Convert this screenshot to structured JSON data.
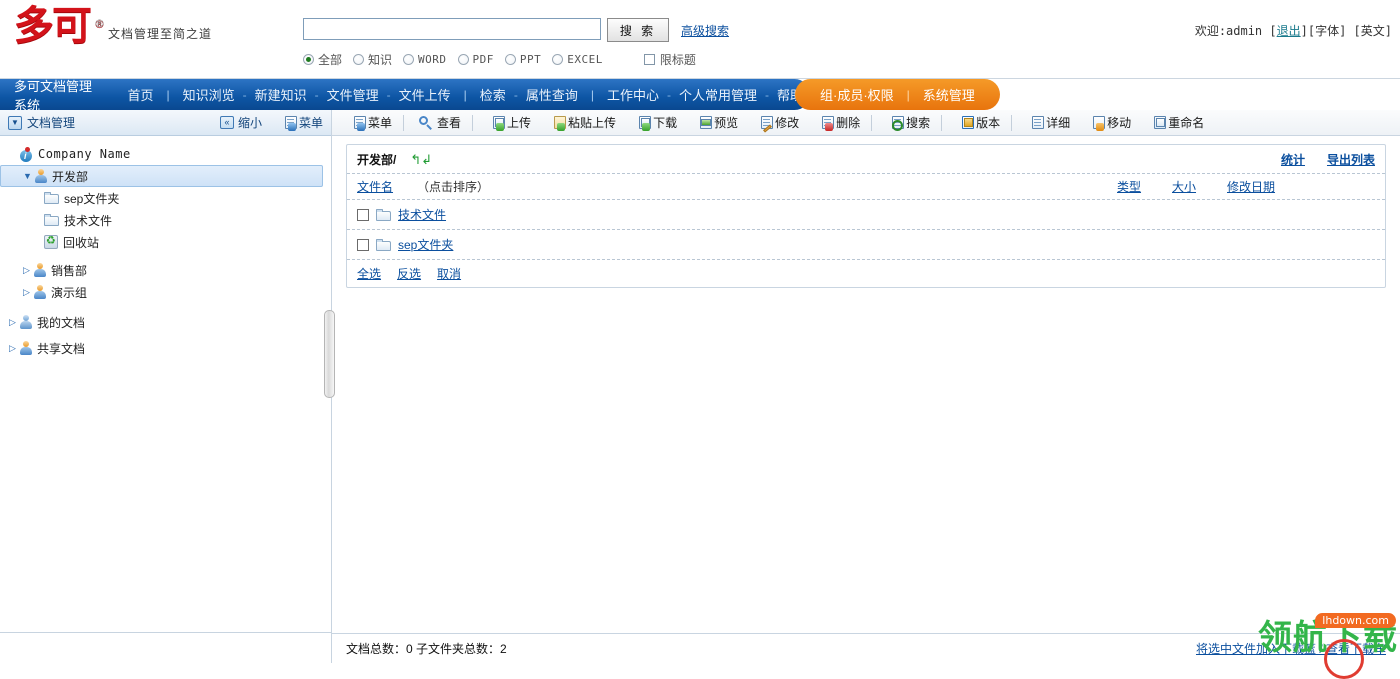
{
  "header": {
    "logo_text": "多可",
    "logo_reg": "®",
    "tagline": "文档管理至简之道",
    "search": {
      "value": "",
      "placeholder": "",
      "button_label": "搜 索",
      "advanced_label": "高级搜索",
      "filters": [
        {
          "label": "全部",
          "selected": true,
          "mono": false
        },
        {
          "label": "知识",
          "selected": false,
          "mono": false
        },
        {
          "label": "WORD",
          "selected": false,
          "mono": true
        },
        {
          "label": "PDF",
          "selected": false,
          "mono": true
        },
        {
          "label": "PPT",
          "selected": false,
          "mono": true
        },
        {
          "label": "EXCEL",
          "selected": false,
          "mono": true
        }
      ],
      "title_only_label": "限标题",
      "title_only_checked": false
    },
    "welcome_prefix": "欢迎:admin [",
    "logout_label": "退出",
    "welcome_suffix": "][字体] [英文]"
  },
  "nav": {
    "brand": "多可文档管理系统",
    "primary": [
      {
        "label": "首页",
        "sep_after": "bar"
      },
      {
        "label": "知识浏览",
        "sep_after": "dash"
      },
      {
        "label": "新建知识",
        "sep_after": "dash"
      },
      {
        "label": "文件管理",
        "sep_after": "dash"
      },
      {
        "label": "文件上传",
        "sep_after": "bar"
      },
      {
        "label": "检索",
        "sep_after": "dash"
      },
      {
        "label": "属性查询",
        "sep_after": "bar"
      },
      {
        "label": "工作中心",
        "sep_after": "dash"
      },
      {
        "label": "个人常用管理",
        "sep_after": "dash"
      },
      {
        "label": "帮助",
        "sep_after": "none"
      }
    ],
    "admin": [
      {
        "label": "组·成员·权限",
        "sep_after": "bar"
      },
      {
        "label": "系统管理",
        "sep_after": "none"
      }
    ],
    "accent_blue": "#0d55a4",
    "accent_orange": "#ee860f"
  },
  "sidebar": {
    "panel_title": "文档管理",
    "minimize_label": "缩小",
    "menu_label": "菜单",
    "tree": [
      {
        "label": "Company Name",
        "icon": "info-icon",
        "level": 0,
        "twist": "",
        "selected": false,
        "mono": true
      },
      {
        "label": "开发部",
        "icon": "group-icon",
        "level": 1,
        "twist": "▼",
        "selected": true,
        "mono": false
      },
      {
        "label": "sep文件夹",
        "icon": "folder-icon",
        "level": 2,
        "twist": "",
        "selected": false,
        "mono": false
      },
      {
        "label": "技术文件",
        "icon": "folder-icon",
        "level": 2,
        "twist": "",
        "selected": false,
        "mono": false
      },
      {
        "label": "回收站",
        "icon": "recycle-icon",
        "level": 2,
        "twist": "",
        "selected": false,
        "mono": false
      },
      {
        "label": "销售部",
        "icon": "group-icon",
        "level": 1,
        "twist": "▷",
        "selected": false,
        "mono": false
      },
      {
        "label": "演示组",
        "icon": "group-icon",
        "level": 1,
        "twist": "▷",
        "selected": false,
        "mono": false
      },
      {
        "label": "我的文档",
        "icon": "user-icon",
        "level": 0,
        "twist": "▷",
        "selected": false,
        "mono": false
      },
      {
        "label": "共享文档",
        "icon": "shared-icon",
        "level": 0,
        "twist": "▷",
        "selected": false,
        "mono": false
      }
    ]
  },
  "toolbar": [
    {
      "label": "菜单",
      "icon": "menu-icon",
      "sep_before": false
    },
    {
      "label": "查看",
      "icon": "view-icon",
      "sep_before": true
    },
    {
      "label": "上传",
      "icon": "upload-icon",
      "sep_before": true
    },
    {
      "label": "粘贴上传",
      "icon": "paste-upload-icon",
      "sep_before": false
    },
    {
      "label": "下载",
      "icon": "download-icon",
      "sep_before": false
    },
    {
      "label": "预览",
      "icon": "preview-icon",
      "sep_before": false
    },
    {
      "label": "修改",
      "icon": "edit-icon",
      "sep_before": false
    },
    {
      "label": "删除",
      "icon": "delete-icon",
      "sep_before": false
    },
    {
      "label": "搜索",
      "icon": "search-icon",
      "sep_before": true
    },
    {
      "label": "版本",
      "icon": "version-icon",
      "sep_before": true
    },
    {
      "label": "详细",
      "icon": "detail-icon",
      "sep_before": true
    },
    {
      "label": "移动",
      "icon": "move-icon",
      "sep_before": false
    },
    {
      "label": "重命名",
      "icon": "rename-icon",
      "sep_before": false
    }
  ],
  "content": {
    "breadcrumb": "开发部/",
    "refresh_icon": "↰↲",
    "stats_label": "统计",
    "export_label": "导出列表",
    "columns": {
      "name": "文件名",
      "name_hint": "（点击排序）",
      "type": "类型",
      "size": "大小",
      "modified": "修改日期"
    },
    "rows": [
      {
        "name": "技术文件",
        "icon": "folder-icon",
        "checked": false,
        "type": "",
        "size": "",
        "modified": ""
      },
      {
        "name": "sep文件夹",
        "icon": "folder-icon",
        "checked": false,
        "type": "",
        "size": "",
        "modified": ""
      }
    ],
    "select_actions": [
      {
        "label": "全选"
      },
      {
        "label": "反选"
      },
      {
        "label": "取消"
      }
    ]
  },
  "status": {
    "text": "文档总数：0  子文件夹总数：2",
    "cart_link": "将选中文件加入下载篮 / 查看下载车"
  },
  "watermark": {
    "text": "领航下载",
    "badge": "lhdown.com"
  }
}
